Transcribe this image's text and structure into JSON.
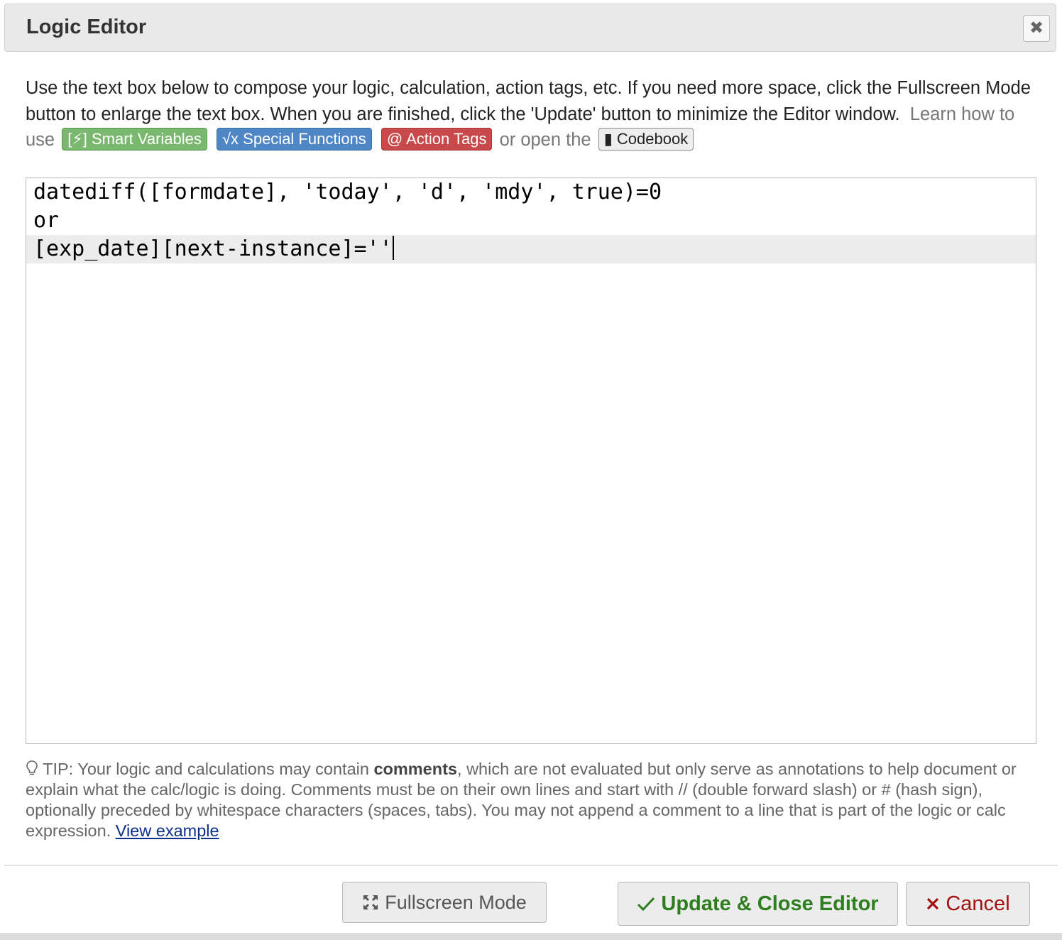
{
  "dialog": {
    "title": "Logic Editor",
    "close_label": "✖"
  },
  "intro": {
    "line_text": "Use the text box below to compose your logic, calculation, action tags, etc. If you need more space, click the Fullscreen Mode button to enlarge the text box. When you are finished, click the 'Update' button to minimize the Editor window.",
    "learn_prefix": "Learn how to use",
    "smart_variables": "[⚡] Smart Variables",
    "special_functions": "√x Special Functions",
    "action_tags": "@ Action Tags",
    "or_open": "or open the",
    "codebook": "Codebook"
  },
  "editor": {
    "lines": [
      "datediff([formdate], 'today', 'd', 'mdy', true)=0",
      "or",
      "[exp_date][next-instance]=''"
    ]
  },
  "tip": {
    "prefix": "TIP: Your logic and calculations may contain ",
    "bold": "comments",
    "suffix": ", which are not evaluated but only serve as annotations to help document or explain what the calc/logic is doing. Comments must be on their own lines and start with // (double forward slash) or # (hash sign), optionally preceded by whitespace characters (spaces, tabs). You may not append a comment to a line that is part of the logic or calc expression. ",
    "link": "View example"
  },
  "footer": {
    "fullscreen_label": "Fullscreen Mode",
    "update_label": "Update & Close Editor",
    "cancel_label": "Cancel"
  },
  "colors": {
    "smart_variables": "#7bb86f",
    "special_functions": "#4f86c6",
    "action_tags": "#c9494a",
    "update_text": "#2e7d1e",
    "cancel_text": "#a31010"
  }
}
